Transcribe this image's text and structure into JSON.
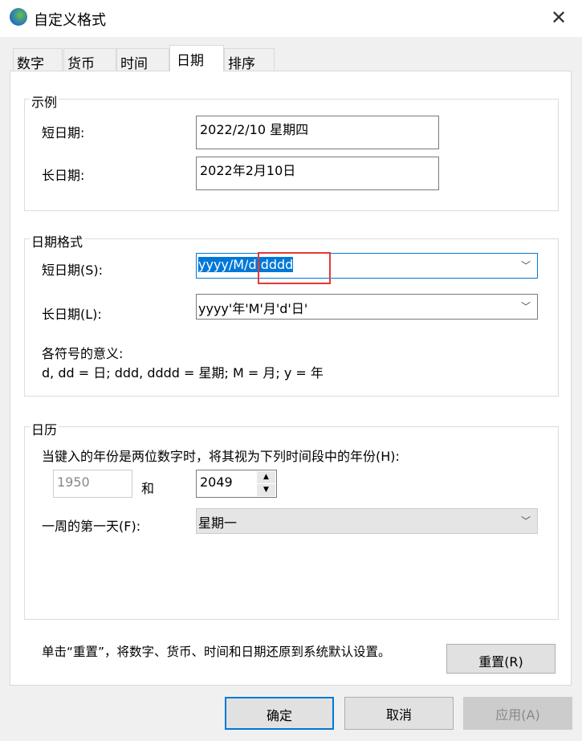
{
  "window": {
    "title": "自定义格式",
    "icon": "globe-clock-icon",
    "close": "✕"
  },
  "tabs": [
    {
      "label": "数字"
    },
    {
      "label": "货币"
    },
    {
      "label": "时间"
    },
    {
      "label": "日期"
    },
    {
      "label": "排序"
    }
  ],
  "example": {
    "title": "示例",
    "short_label": "短日期:",
    "short_value": "2022/2/10 星期四",
    "long_label": "长日期:",
    "long_value": "2022年2月10日"
  },
  "format": {
    "title": "日期格式",
    "short_label": "短日期(S):",
    "short_value_pre": "yyyy/M/",
    "short_value_post": "d dddd",
    "long_label": "长日期(L):",
    "long_value": "yyyy'年'M'月'd'日'",
    "legend_title": "各符号的意义:",
    "legend": "d, dd = 日;  ddd, dddd = 星期;  M = 月;  y = 年"
  },
  "calendar": {
    "title": "日历",
    "two_digit_label": "当键入的年份是两位数字时，将其视为下列时间段中的年份(H):",
    "from_year": "1950",
    "and": "和",
    "to_year": "2049",
    "first_day_label": "一周的第一天(F):",
    "first_day_value": "星期一"
  },
  "footer": {
    "note": "单击“重置”，将数字、货币、时间和日期还原到系统默认设置。",
    "reset": "重置(R)",
    "ok": "确定",
    "cancel": "取消",
    "apply": "应用(A)"
  },
  "colors": {
    "accent": "#0078d7",
    "highlight_box": "#e53935"
  }
}
